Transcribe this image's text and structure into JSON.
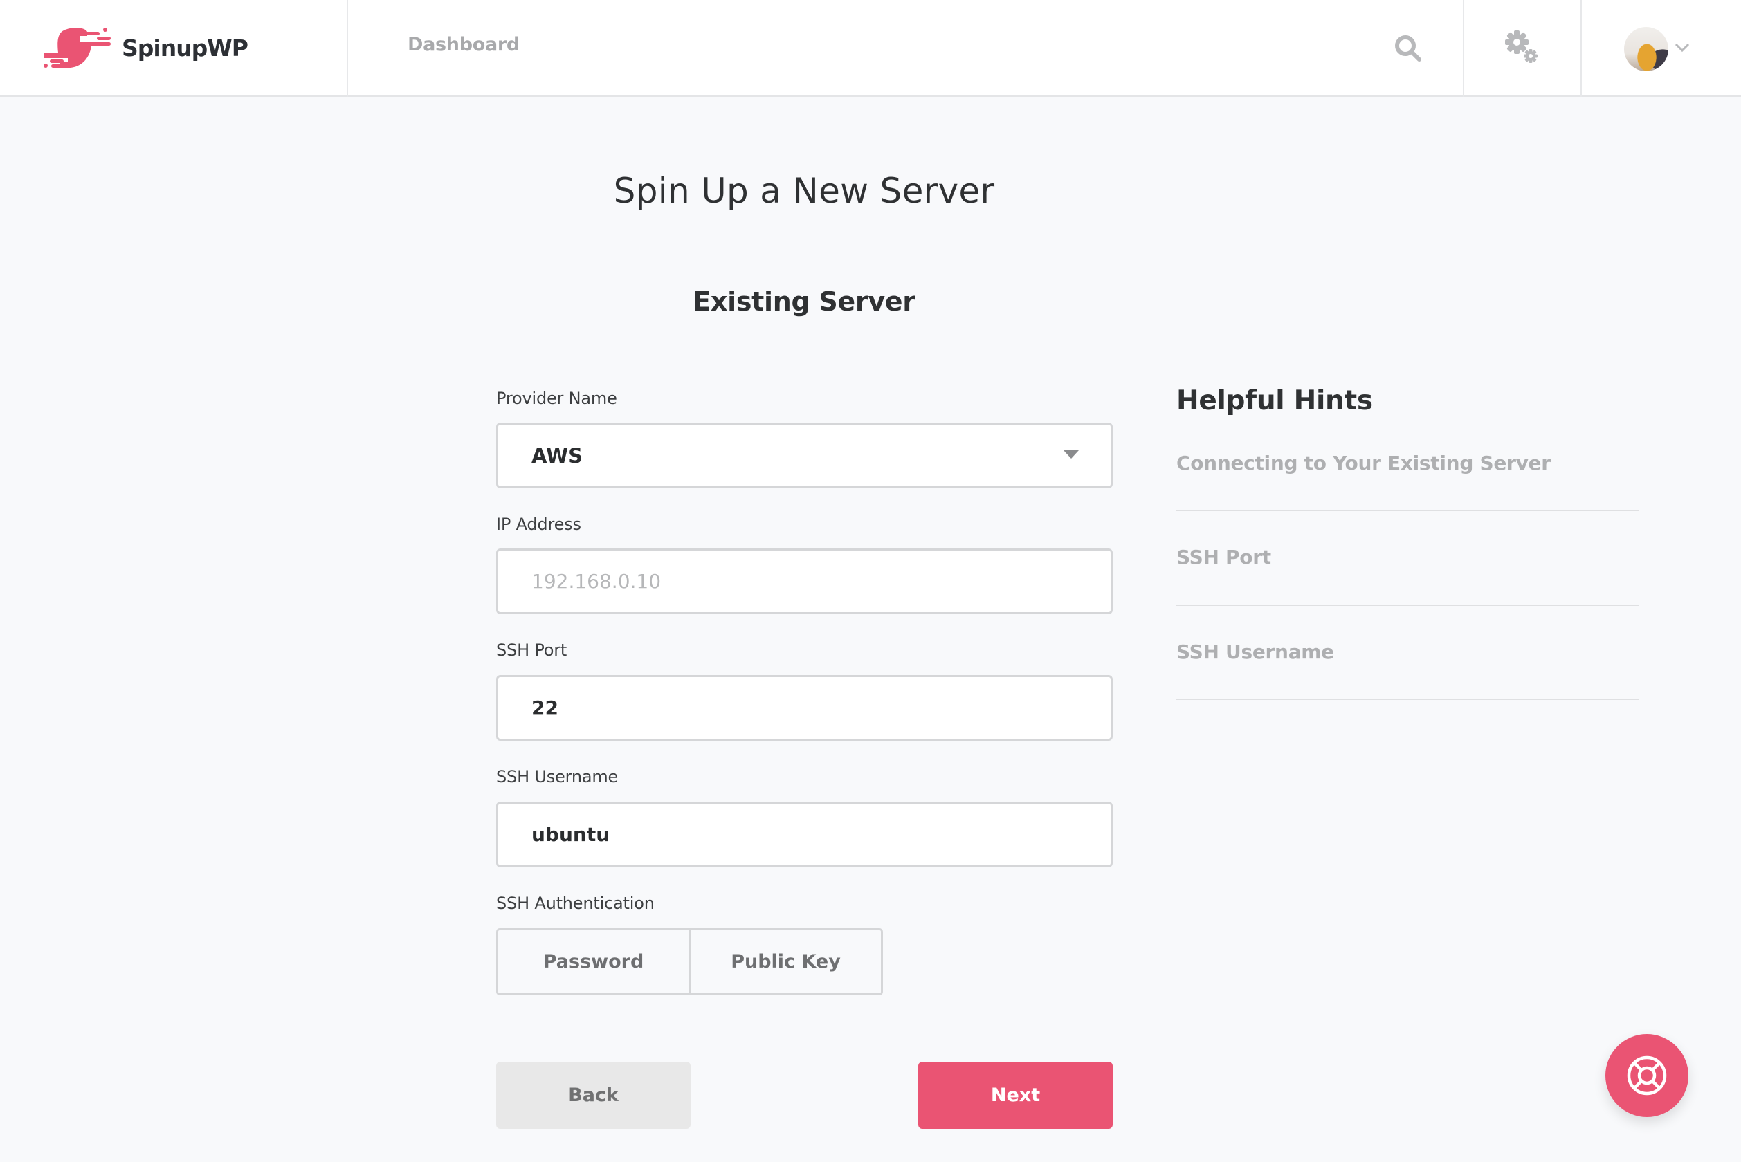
{
  "header": {
    "brand": "SpinupWP",
    "nav": [
      {
        "label": "Dashboard"
      }
    ],
    "icons": {
      "search": "search-icon",
      "settings": "gears-icon",
      "avatar": "user-avatar",
      "menu": "chevron-down-icon"
    }
  },
  "page": {
    "title": "Spin Up a New Server",
    "subtitle": "Existing Server"
  },
  "form": {
    "provider": {
      "label": "Provider Name",
      "value": "AWS"
    },
    "ip": {
      "label": "IP Address",
      "value": "",
      "placeholder": "192.168.0.10"
    },
    "ssh_port": {
      "label": "SSH Port",
      "value": "22"
    },
    "ssh_username": {
      "label": "SSH Username",
      "value": "ubuntu"
    },
    "ssh_auth": {
      "label": "SSH Authentication",
      "options": [
        {
          "label": "Password"
        },
        {
          "label": "Public Key"
        }
      ]
    },
    "back_label": "Back",
    "next_label": "Next"
  },
  "hints": {
    "title": "Helpful Hints",
    "items": [
      {
        "label": "Connecting to Your Existing Server"
      },
      {
        "label": "SSH Port"
      },
      {
        "label": "SSH Username"
      }
    ]
  },
  "help": {
    "icon": "lifebuoy-icon"
  },
  "colors": {
    "brand": "#ea5473",
    "background": "#f8f9fb",
    "muted_text": "#aeafb1"
  }
}
